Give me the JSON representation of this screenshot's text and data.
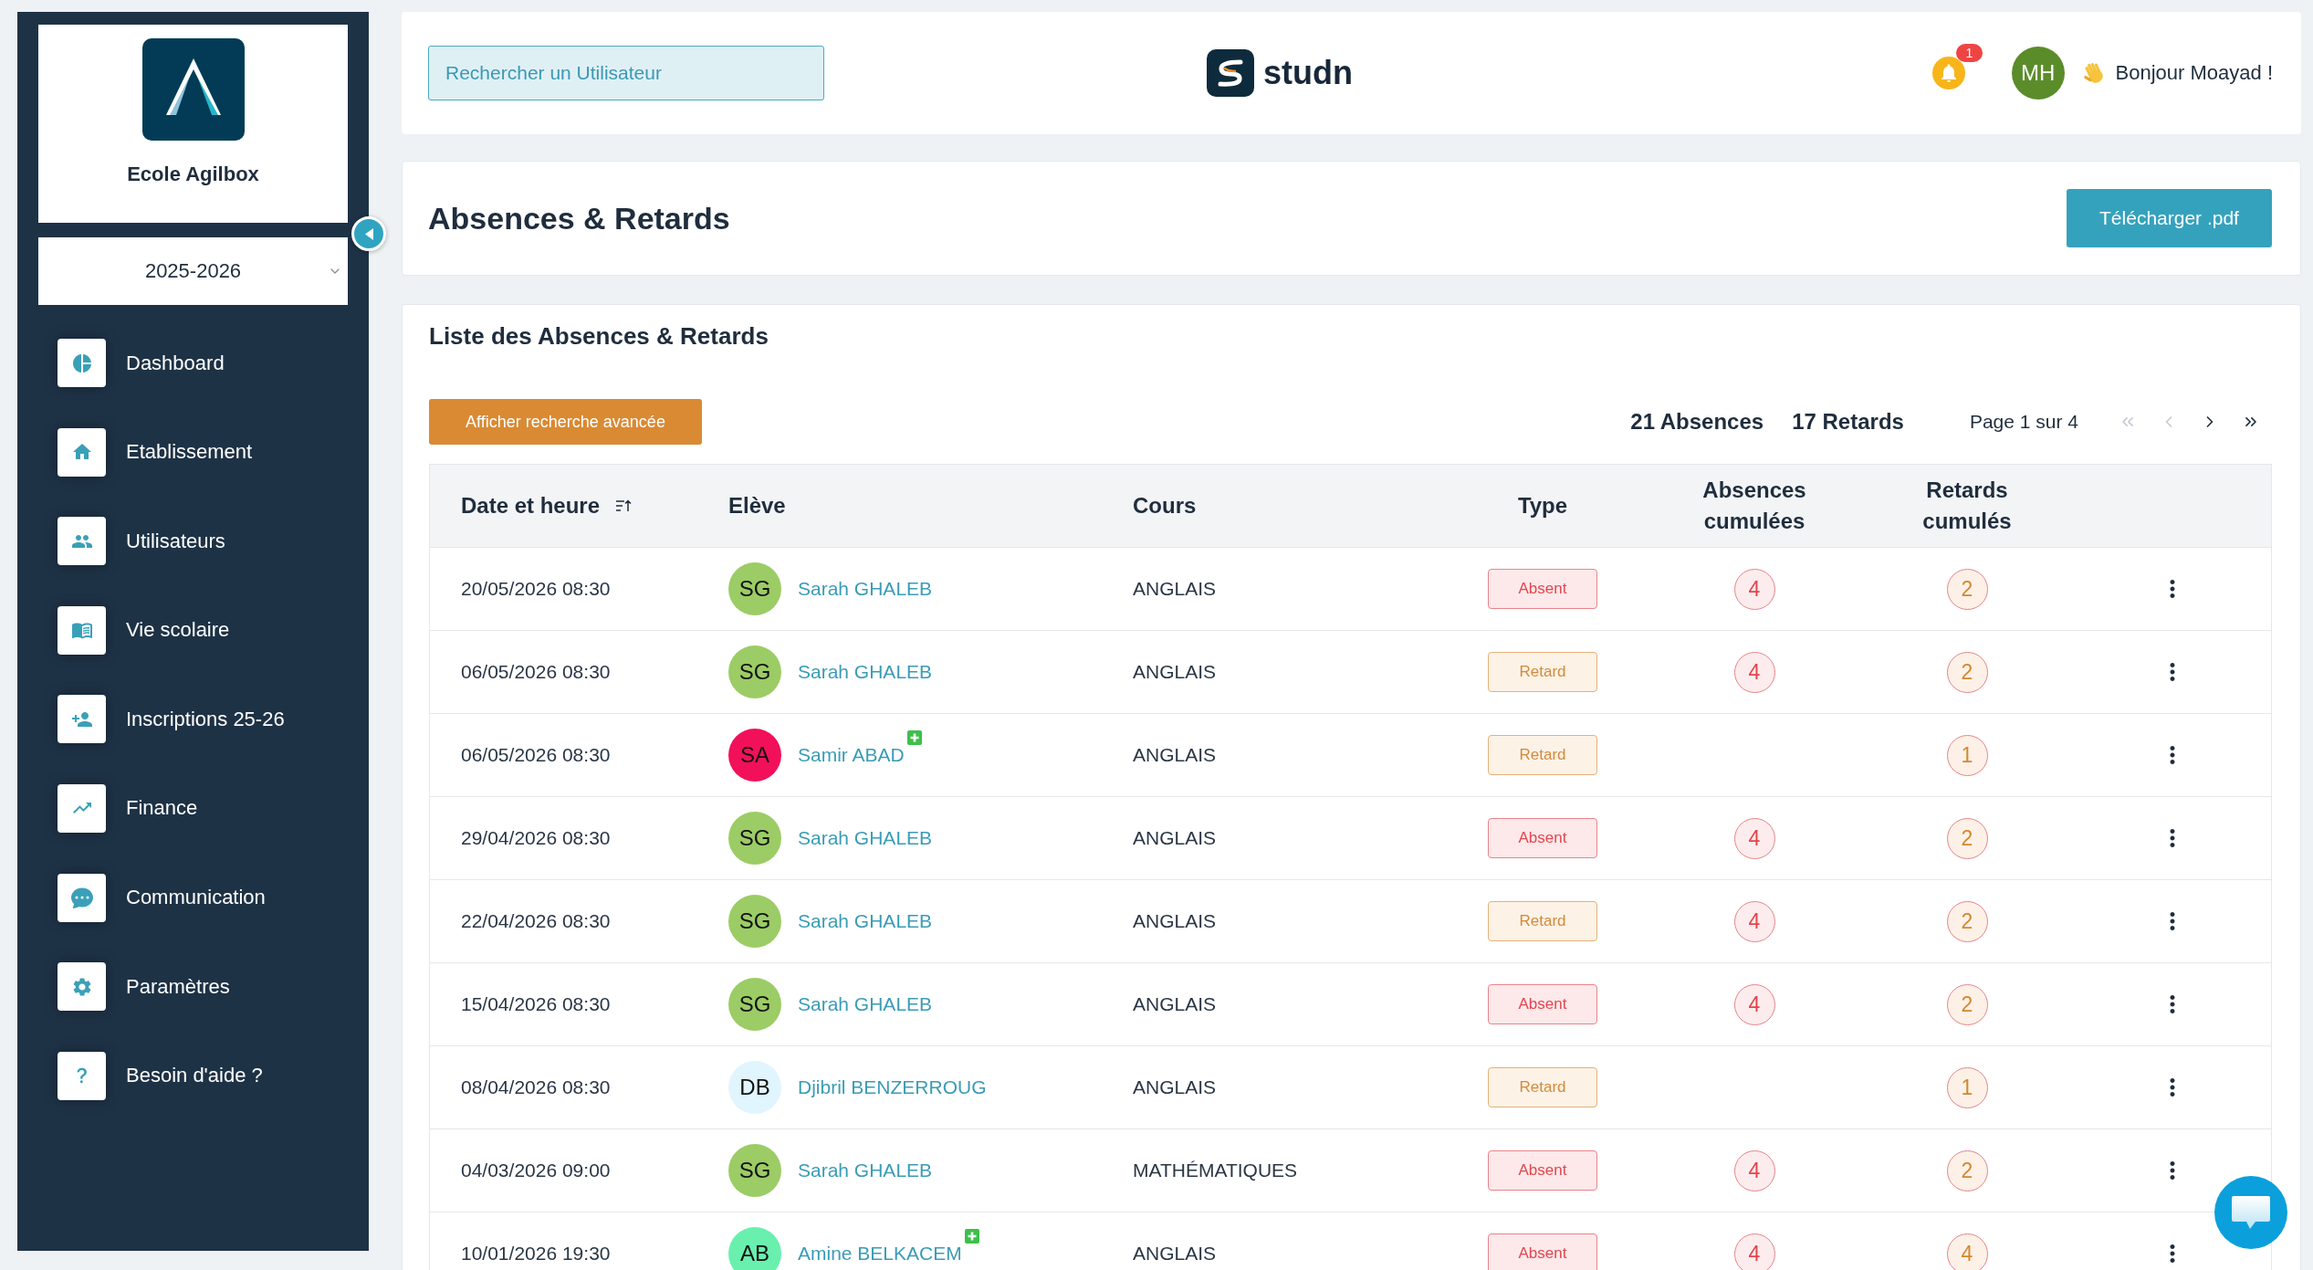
{
  "sidebar": {
    "school_name": "Ecole Agilbox",
    "year_select": {
      "value": "2025-2026"
    },
    "items": [
      {
        "label": "Dashboard",
        "selected": false
      },
      {
        "label": "Etablissement",
        "selected": false
      },
      {
        "label": "Utilisateurs",
        "selected": false
      },
      {
        "label": "Vie scolaire",
        "selected": false
      },
      {
        "label": "Inscriptions 25-26",
        "selected": false
      },
      {
        "label": "Finance",
        "selected": false
      },
      {
        "label": "Communication",
        "selected": false
      },
      {
        "label": "Paramètres",
        "selected": false
      },
      {
        "label": "Besoin d'aide ?",
        "selected": false
      }
    ]
  },
  "header": {
    "search": {
      "placeholder": "Rechercher un Utilisateur"
    },
    "brand": "studn",
    "notifications": {
      "count": "1"
    },
    "user": {
      "initials": "MH",
      "greeting": "Bonjour Moayad !"
    }
  },
  "page_header": {
    "title": "Absences & Retards",
    "download_button": "Télécharger .pdf"
  },
  "list": {
    "title": "Liste des Absences & Retards",
    "advanced_search_button": "Afficher recherche avancée",
    "totals": [
      "21 Absences",
      "17 Retards"
    ],
    "pagination": {
      "label": "Page 1 sur 4",
      "controls": [
        {
          "kind": "first",
          "disabled": true
        },
        {
          "kind": "prev",
          "disabled": true
        },
        {
          "kind": "next",
          "disabled": false
        },
        {
          "kind": "last",
          "disabled": false
        }
      ]
    },
    "table": {
      "columns": [
        {
          "label": "Date et heure",
          "sorted": true
        },
        {
          "label": "Elève",
          "sorted": false
        },
        {
          "label": "Cours",
          "sorted": false
        },
        {
          "label": "Type",
          "sorted": false
        },
        {
          "label": "Absences cumulées",
          "sorted": false
        },
        {
          "label": "Retards cumulés",
          "sorted": false
        }
      ],
      "rows": [
        {
          "datetime": "20/05/2026 08:30",
          "student": {
            "initials": "SG",
            "name": "Sarah GHALEB",
            "color": "#9ccc65",
            "plus_badge": false
          },
          "course": "ANGLAIS",
          "type": {
            "kind": "absent",
            "label": "Absent"
          },
          "absences_total": "4",
          "retards_total": "2"
        },
        {
          "datetime": "06/05/2026 08:30",
          "student": {
            "initials": "SG",
            "name": "Sarah GHALEB",
            "color": "#9ccc65",
            "plus_badge": false
          },
          "course": "ANGLAIS",
          "type": {
            "kind": "retard",
            "label": "Retard"
          },
          "absences_total": "4",
          "retards_total": "2"
        },
        {
          "datetime": "06/05/2026 08:30",
          "student": {
            "initials": "SA",
            "name": "Samir ABAD",
            "color": "#f2105a",
            "plus_badge": true
          },
          "course": "ANGLAIS",
          "type": {
            "kind": "retard",
            "label": "Retard"
          },
          "retards_total": "1"
        },
        {
          "datetime": "29/04/2026 08:30",
          "student": {
            "initials": "SG",
            "name": "Sarah GHALEB",
            "color": "#9ccc65",
            "plus_badge": false
          },
          "course": "ANGLAIS",
          "type": {
            "kind": "absent",
            "label": "Absent"
          },
          "absences_total": "4",
          "retards_total": "2"
        },
        {
          "datetime": "22/04/2026 08:30",
          "student": {
            "initials": "SG",
            "name": "Sarah GHALEB",
            "color": "#9ccc65",
            "plus_badge": false
          },
          "course": "ANGLAIS",
          "type": {
            "kind": "retard",
            "label": "Retard"
          },
          "absences_total": "4",
          "retards_total": "2"
        },
        {
          "datetime": "15/04/2026 08:30",
          "student": {
            "initials": "SG",
            "name": "Sarah GHALEB",
            "color": "#9ccc65",
            "plus_badge": false
          },
          "course": "ANGLAIS",
          "type": {
            "kind": "absent",
            "label": "Absent"
          },
          "absences_total": "4",
          "retards_total": "2"
        },
        {
          "datetime": "08/04/2026 08:30",
          "student": {
            "initials": "DB",
            "name": "Djibril BENZERROUG",
            "color": "#e1f5fe",
            "plus_badge": false
          },
          "course": "ANGLAIS",
          "type": {
            "kind": "retard",
            "label": "Retard"
          },
          "retards_total": "1"
        },
        {
          "datetime": "04/03/2026 09:00",
          "student": {
            "initials": "SG",
            "name": "Sarah GHALEB",
            "color": "#9ccc65",
            "plus_badge": false
          },
          "course": "MATHÉMATIQUES",
          "type": {
            "kind": "absent",
            "label": "Absent"
          },
          "absences_total": "4",
          "retards_total": "2"
        },
        {
          "datetime": "10/01/2026 19:30",
          "student": {
            "initials": "AB",
            "name": "Amine BELKACEM",
            "color": "#69f0ae",
            "plus_badge": true
          },
          "course": "ANGLAIS",
          "type": {
            "kind": "absent",
            "label": "Absent"
          },
          "absences_total": "4",
          "retards_total": "4"
        }
      ]
    }
  }
}
